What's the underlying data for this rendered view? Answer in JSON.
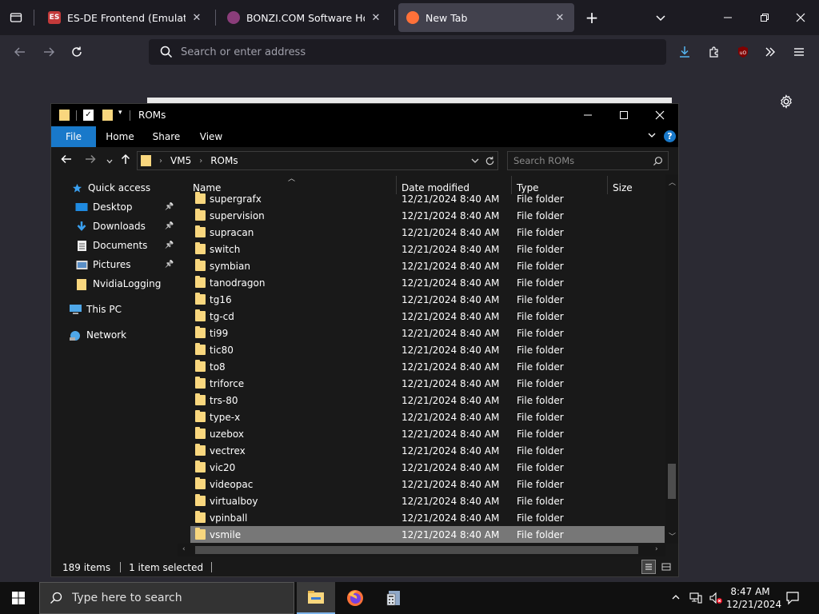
{
  "browser": {
    "tabs": [
      {
        "title": "ES-DE Frontend (EmulationStation",
        "favicon": "ES",
        "favicon_color": "#c43a3a",
        "active": false
      },
      {
        "title": "BONZI.COM Software Home P",
        "favicon": "",
        "favicon_color": "#8a3d7a",
        "active": false
      },
      {
        "title": "New Tab",
        "favicon": "",
        "favicon_color": "#ff7139",
        "active": true
      }
    ],
    "url_placeholder": "Search or enter address"
  },
  "explorer": {
    "title": "ROMs",
    "ribbon_tabs": [
      "File",
      "Home",
      "Share",
      "View"
    ],
    "address_path": [
      "VM5",
      "ROMs"
    ],
    "search_placeholder": "Search ROMs",
    "nav_pane": [
      {
        "label": "Quick access",
        "icon": "star-icon",
        "pinned": false
      },
      {
        "label": "Desktop",
        "icon": "desktop-icon",
        "pinned": true
      },
      {
        "label": "Downloads",
        "icon": "download-icon",
        "pinned": true
      },
      {
        "label": "Documents",
        "icon": "document-icon",
        "pinned": true
      },
      {
        "label": "Pictures",
        "icon": "picture-icon",
        "pinned": true
      },
      {
        "label": "NvidiaLogging",
        "icon": "folder-icon",
        "pinned": false
      },
      {
        "label": "This PC",
        "icon": "computer-icon",
        "pinned": false
      },
      {
        "label": "Network",
        "icon": "network-icon",
        "pinned": false
      }
    ],
    "columns": [
      "Name",
      "Date modified",
      "Type",
      "Size"
    ],
    "files": [
      {
        "name": "supergrafx",
        "date": "12/21/2024 8:40 AM",
        "type": "File folder"
      },
      {
        "name": "supervision",
        "date": "12/21/2024 8:40 AM",
        "type": "File folder"
      },
      {
        "name": "supracan",
        "date": "12/21/2024 8:40 AM",
        "type": "File folder"
      },
      {
        "name": "switch",
        "date": "12/21/2024 8:40 AM",
        "type": "File folder"
      },
      {
        "name": "symbian",
        "date": "12/21/2024 8:40 AM",
        "type": "File folder"
      },
      {
        "name": "tanodragon",
        "date": "12/21/2024 8:40 AM",
        "type": "File folder"
      },
      {
        "name": "tg16",
        "date": "12/21/2024 8:40 AM",
        "type": "File folder"
      },
      {
        "name": "tg-cd",
        "date": "12/21/2024 8:40 AM",
        "type": "File folder"
      },
      {
        "name": "ti99",
        "date": "12/21/2024 8:40 AM",
        "type": "File folder"
      },
      {
        "name": "tic80",
        "date": "12/21/2024 8:40 AM",
        "type": "File folder"
      },
      {
        "name": "to8",
        "date": "12/21/2024 8:40 AM",
        "type": "File folder"
      },
      {
        "name": "triforce",
        "date": "12/21/2024 8:40 AM",
        "type": "File folder"
      },
      {
        "name": "trs-80",
        "date": "12/21/2024 8:40 AM",
        "type": "File folder"
      },
      {
        "name": "type-x",
        "date": "12/21/2024 8:40 AM",
        "type": "File folder"
      },
      {
        "name": "uzebox",
        "date": "12/21/2024 8:40 AM",
        "type": "File folder"
      },
      {
        "name": "vectrex",
        "date": "12/21/2024 8:40 AM",
        "type": "File folder"
      },
      {
        "name": "vic20",
        "date": "12/21/2024 8:40 AM",
        "type": "File folder"
      },
      {
        "name": "videopac",
        "date": "12/21/2024 8:40 AM",
        "type": "File folder"
      },
      {
        "name": "virtualboy",
        "date": "12/21/2024 8:40 AM",
        "type": "File folder"
      },
      {
        "name": "vpinball",
        "date": "12/21/2024 8:40 AM",
        "type": "File folder"
      },
      {
        "name": "vsmile",
        "date": "12/21/2024 8:40 AM",
        "type": "File folder",
        "selected": true
      }
    ],
    "status": {
      "item_count": "189 items",
      "selection": "1 item selected"
    }
  },
  "taskbar": {
    "search_placeholder": "Type here to search",
    "time": "8:47 AM",
    "date": "12/21/2024"
  },
  "colors": {
    "accent": "#1979ca",
    "folder": "#f9d77e",
    "selected_row": "#777777"
  }
}
